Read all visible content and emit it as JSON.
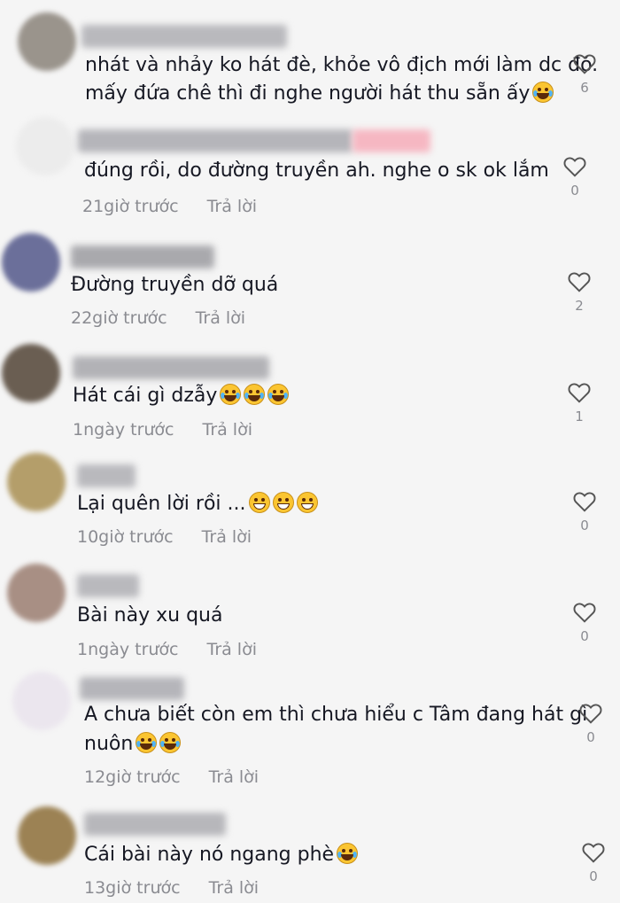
{
  "comments": [
    {
      "lines": [
        "nhát và nhảy ko hát đè, khỏe vô địch mới làm dc đó.",
        "mấy đứa chê thì đi nghe người hát thu sẵn ấy"
      ],
      "emojis": [
        "joy"
      ],
      "time": "",
      "reply_label": "",
      "likes": "6"
    },
    {
      "lines": [
        "đúng rồi, do đường truyền ah. nghe o sk ok lắm"
      ],
      "emojis": [],
      "time": "21giờ trước",
      "reply_label": "Trả lời",
      "likes": "0"
    },
    {
      "lines": [
        "Đường truyền dỡ quá"
      ],
      "emojis": [],
      "time": "22giờ trước",
      "reply_label": "Trả lời",
      "likes": "2"
    },
    {
      "lines": [
        "Hát cái gì dzẫy"
      ],
      "emojis": [
        "joy",
        "joy",
        "joy"
      ],
      "time": "1ngày trước",
      "reply_label": "Trả lời",
      "likes": "1"
    },
    {
      "lines": [
        "Lại quên lời rồi ..."
      ],
      "emojis": [
        "grin",
        "grin",
        "grin"
      ],
      "time": "10giờ trước",
      "reply_label": "Trả lời",
      "likes": "0"
    },
    {
      "lines": [
        "Bài này xu quá"
      ],
      "emojis": [],
      "time": "1ngày trước",
      "reply_label": "Trả lời",
      "likes": "0"
    },
    {
      "lines": [
        "A chưa biết còn em thì chưa hiểu c Tâm đang hát gì",
        "nuôn"
      ],
      "emojis": [
        "joy",
        "joy"
      ],
      "time": "12giờ trước",
      "reply_label": "Trả lời",
      "likes": "0"
    },
    {
      "lines": [
        "Cái bài này nó ngang phè"
      ],
      "emojis": [
        "joy"
      ],
      "time": "13giờ trước",
      "reply_label": "Trả lời",
      "likes": "0"
    }
  ],
  "icons": {
    "like": "heart-outline-icon",
    "emoji_joy": "face-with-tears-of-joy-icon",
    "emoji_grin": "grinning-face-icon"
  },
  "colors": {
    "background": "#f5f5f5",
    "text": "#161823",
    "meta": "#8a8b91"
  }
}
